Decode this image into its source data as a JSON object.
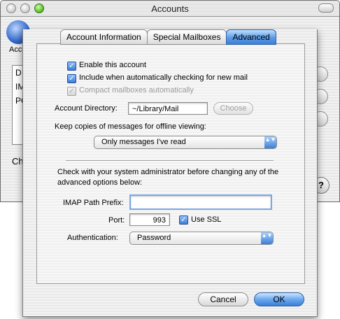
{
  "window": {
    "title": "Accounts"
  },
  "background": {
    "toolbar_label": "Acco",
    "list_items": [
      "D",
      "IM",
      "PO"
    ],
    "bottom_text": "Ch",
    "help_label": "?"
  },
  "tabs": [
    {
      "label": "Account Information",
      "active": false
    },
    {
      "label": "Special Mailboxes",
      "active": false
    },
    {
      "label": "Advanced",
      "active": true
    }
  ],
  "options": {
    "enable_account": {
      "label": "Enable this account",
      "checked": true
    },
    "include_auto_check": {
      "label": "Include when automatically checking for new mail",
      "checked": true
    },
    "compact_mailboxes": {
      "label": "Compact mailboxes automatically",
      "checked": true,
      "disabled": true
    }
  },
  "account_directory": {
    "label": "Account Directory:",
    "value": "~/Library/Mail",
    "choose_button": "Choose"
  },
  "offline": {
    "label": "Keep copies of messages for offline viewing:",
    "selected": "Only messages I've read"
  },
  "notice": {
    "line1": "Check with your system administrator before changing any of the",
    "line2": "advanced options below:"
  },
  "imap_prefix": {
    "label": "IMAP Path Prefix:",
    "value": ""
  },
  "port": {
    "label": "Port:",
    "value": "993"
  },
  "ssl": {
    "label": "Use SSL",
    "checked": true
  },
  "authentication": {
    "label": "Authentication:",
    "selected": "Password"
  },
  "buttons": {
    "cancel": "Cancel",
    "ok": "OK"
  },
  "glyphs": {
    "check": "✓",
    "popup_arrows": "▲▼"
  },
  "colors": {
    "accent": "#3c7fd6",
    "dim_text": "#9a9a9a"
  }
}
